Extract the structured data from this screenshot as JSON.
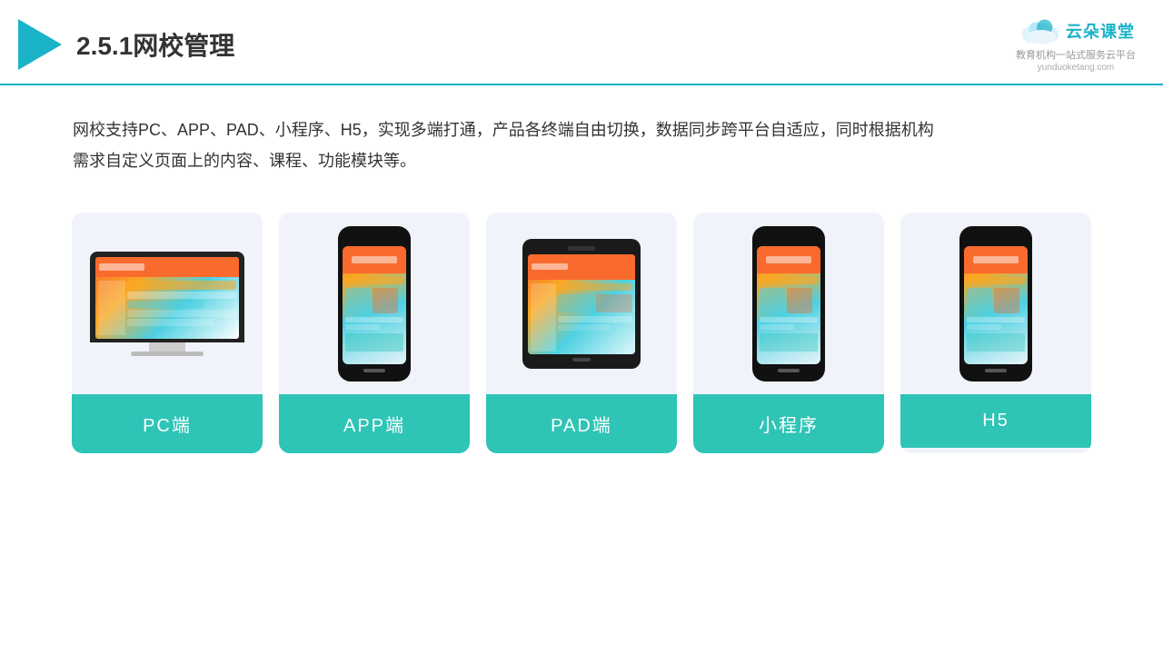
{
  "header": {
    "title": "2.5.1网校管理",
    "logo_name": "云朵课堂",
    "logo_tagline": "教育机构一站\n式服务云平台",
    "logo_url": "yunduoketang.com"
  },
  "description": {
    "text": "网校支持PC、APP、PAD、小程序、H5，实现多端打通，产品各终端自由切换，数据同步跨平台自适应，同时根据机构需求自定义页面上的内容、课程、功能模块等。"
  },
  "cards": [
    {
      "id": "pc",
      "label": "PC端",
      "type": "pc"
    },
    {
      "id": "app",
      "label": "APP端",
      "type": "phone"
    },
    {
      "id": "pad",
      "label": "PAD端",
      "type": "tablet"
    },
    {
      "id": "miniprogram",
      "label": "小程序",
      "type": "phone"
    },
    {
      "id": "h5",
      "label": "H5",
      "type": "phone"
    }
  ],
  "colors": {
    "teal": "#2ec4b6",
    "teal_light": "#1ab3c8",
    "bg_card": "#eef2f8"
  }
}
